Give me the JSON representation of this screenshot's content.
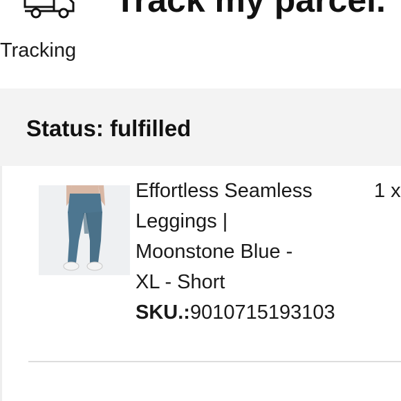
{
  "header": {
    "title": "Track my parcel.",
    "tracking_label": "Tracking",
    "tracking_icon": "delivery-truck-icon"
  },
  "order": {
    "status_text": "Status: fulfilled"
  },
  "item": {
    "name_lines": [
      "Effortless Seamless",
      "Leggings |",
      "Moonstone Blue -",
      "XL - Short"
    ],
    "sku_label": "SKU.:",
    "sku_value": "9010715193103",
    "quantity": "1 x",
    "image": "product-thumbnail-leggings"
  },
  "colors": {
    "status_band": "#f3f3f3",
    "text": "#111111",
    "leggings": "#4d7690"
  }
}
